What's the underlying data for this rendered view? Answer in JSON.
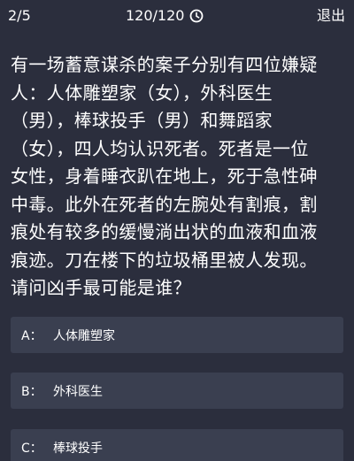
{
  "header": {
    "progress": "2/5",
    "timer": "120/120",
    "exit_label": "退出"
  },
  "question": {
    "text": "有一场蓄意谋杀的案子分别有四位嫌疑\n人：人体雕塑家（女），外科医生\n（男），棒球投手（男）和舞蹈家\n（女），四人均认识死者。死者是一位\n女性，身着睡衣趴在地上，死于急性砷\n中毒。此外在死者的左腕处有割痕，割\n痕处有较多的缓慢淌出状的血液和血液\n痕迹。刀在楼下的垃圾桶里被人发现。\n请问凶手最可能是谁？"
  },
  "options": [
    {
      "letter": "A：",
      "text": "人体雕塑家"
    },
    {
      "letter": "B：",
      "text": "外科医生"
    },
    {
      "letter": "C：",
      "text": "棒球投手"
    }
  ],
  "colors": {
    "background": "#2b2e3d",
    "option_background": "#3a3f50",
    "text": "#ffffff"
  },
  "icons": {
    "timer": "clock-icon"
  }
}
